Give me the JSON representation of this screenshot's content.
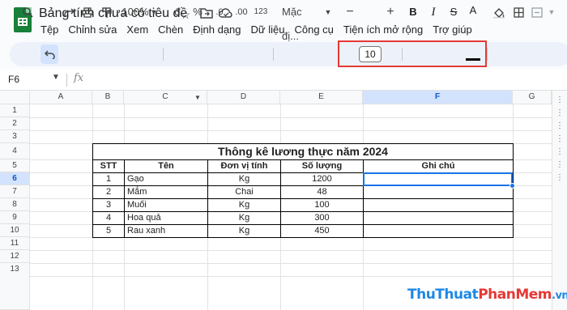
{
  "doc": {
    "title": "Bảng tính chưa có tiêu đề",
    "menu": [
      "Tệp",
      "Chỉnh sửa",
      "Xem",
      "Chèn",
      "Định dạng",
      "Dữ liệu",
      "Công cụ",
      "Tiện ích mở rộng",
      "Trợ giúp"
    ]
  },
  "toolbar": {
    "zoom": "100%",
    "currency": "đ",
    "percent": "%",
    "dec_decrease": ".0",
    "dec_increase": ".00",
    "num_format": "123",
    "font_family": "Mặc đị...",
    "font_size": "10",
    "bold": "B",
    "italic": "I",
    "strike": "S",
    "text_color": "A"
  },
  "formula_bar": {
    "name_box": "F6",
    "fx": "fx"
  },
  "columns": [
    "A",
    "B",
    "C",
    "D",
    "E",
    "F",
    "G"
  ],
  "rows": [
    "1",
    "2",
    "3",
    "4",
    "5",
    "6",
    "7",
    "8",
    "9",
    "10",
    "11",
    "12",
    "13"
  ],
  "table": {
    "title": "Thông kê lương thực năm 2024",
    "headers": [
      "STT",
      "Tên",
      "Đơn vị tính",
      "Số lượng",
      "Ghi chú"
    ],
    "rows": [
      [
        "1",
        "Gạo",
        "Kg",
        "1200",
        ""
      ],
      [
        "2",
        "Mắm",
        "Chai",
        "48",
        ""
      ],
      [
        "3",
        "Muối",
        "Kg",
        "100",
        ""
      ],
      [
        "4",
        "Hoa quả",
        "Kg",
        "300",
        ""
      ],
      [
        "5",
        "Rau xanh",
        "Kg",
        "450",
        ""
      ]
    ]
  },
  "watermark": {
    "part1": "ThuThuat",
    "part2": "PhanMem",
    "part3": ".vn"
  },
  "colors": {
    "accent": "#1a73e8",
    "highlight": "#e53935",
    "sheets_green": "#188038"
  }
}
